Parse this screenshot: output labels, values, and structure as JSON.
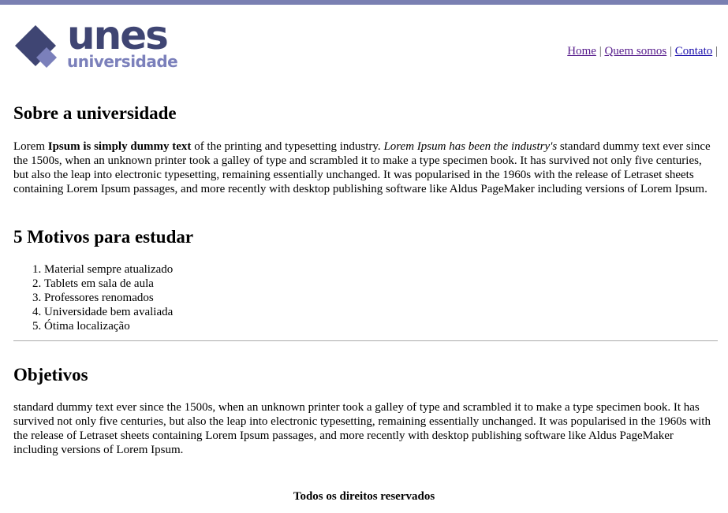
{
  "colors": {
    "accent": "#7a80b2",
    "logo_dark": "#3f4573",
    "logo_light": "#7b80bb",
    "link": "#551a8b",
    "link_visited": "#1a0dab"
  },
  "logo": {
    "word": "unes",
    "sub": "universidade"
  },
  "nav": {
    "items": [
      "Home",
      "Quem somos",
      "Contato"
    ],
    "separator": "|"
  },
  "about": {
    "title": "Sobre a universidade",
    "p_lead": "Lorem ",
    "p_bold": "Ipsum is simply dummy text",
    "p_mid": " of the printing and typesetting industry. ",
    "p_italic": "Lorem Ipsum has been the industry's",
    "p_rest": " standard dummy text ever since the 1500s, when an unknown printer took a galley of type and scrambled it to make a type specimen book. It has survived not only five centuries, but also the leap into electronic typesetting, remaining essentially unchanged. It was popularised in the 1960s with the release of Letraset sheets containing Lorem Ipsum passages, and more recently with desktop publishing software like Aldus PageMaker including versions of Lorem Ipsum."
  },
  "reasons": {
    "title": "5 Motivos para estudar",
    "items": [
      "Material sempre atualizado",
      "Tablets em sala de aula",
      "Professores renomados",
      "Universidade bem avaliada",
      "Ótima localização"
    ]
  },
  "objectives": {
    "title": "Objetivos",
    "text": "standard dummy text ever since the 1500s, when an unknown printer took a galley of type and scrambled it to make a type specimen book. It has survived not only five centuries, but also the leap into electronic typesetting, remaining essentially unchanged. It was popularised in the 1960s with the release of Letraset sheets containing Lorem Ipsum passages, and more recently with desktop publishing software like Aldus PageMaker including versions of Lorem Ipsum."
  },
  "footer": {
    "text": "Todos os direitos reservados"
  }
}
